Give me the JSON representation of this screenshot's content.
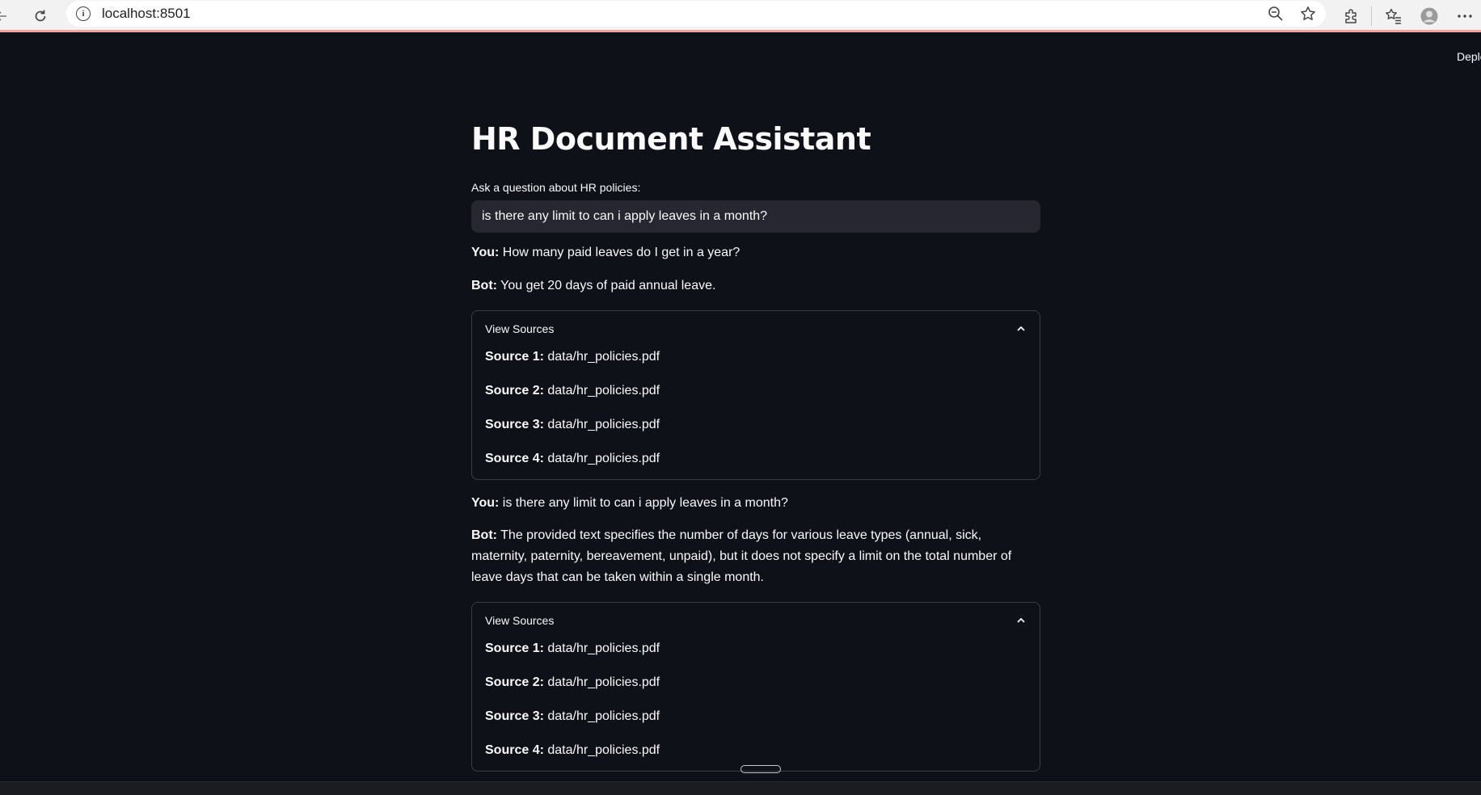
{
  "browser": {
    "url": "localhost:8501"
  },
  "app": {
    "deploy_label": "Deploy",
    "title": "HR Document Assistant",
    "question_label": "Ask a question about HR policies:",
    "question_value": "is there any limit to can i apply leaves in a month?"
  },
  "chat": [
    {
      "you_label": "You:",
      "you_text": " How many paid leaves do I get in a year?",
      "bot_label": "Bot:",
      "bot_text": " You get 20 days of paid annual leave.",
      "expander_label": "View Sources",
      "sources": [
        {
          "label": "Source 1:",
          "value": " data/hr_policies.pdf"
        },
        {
          "label": "Source 2:",
          "value": " data/hr_policies.pdf"
        },
        {
          "label": "Source 3:",
          "value": " data/hr_policies.pdf"
        },
        {
          "label": "Source 4:",
          "value": " data/hr_policies.pdf"
        }
      ]
    },
    {
      "you_label": "You:",
      "you_text": " is there any limit to can i apply leaves in a month?",
      "bot_label": "Bot:",
      "bot_text": " The provided text specifies the number of days for various leave types (annual, sick, maternity, paternity, bereavement, unpaid), but it does not specify a limit on the total number of leave days that can be taken within a single month.",
      "expander_label": "View Sources",
      "sources": [
        {
          "label": "Source 1:",
          "value": " data/hr_policies.pdf"
        },
        {
          "label": "Source 2:",
          "value": " data/hr_policies.pdf"
        },
        {
          "label": "Source 3:",
          "value": " data/hr_policies.pdf"
        },
        {
          "label": "Source 4:",
          "value": " data/hr_policies.pdf"
        }
      ]
    }
  ],
  "icons": {
    "back": "back-arrow-icon",
    "reload": "reload-icon",
    "info": "site-info-icon",
    "zoom": "zoom-out-icon",
    "favorite": "star-icon",
    "extensions": "puzzle-icon",
    "favorites_list": "favorites-icon",
    "profile": "profile-icon",
    "menu": "more-icon",
    "expander": "chevron-up-icon"
  },
  "colors": {
    "app_background": "#0e1117",
    "input_background": "#262730",
    "text": "#fafafa",
    "border": "#3a3d45"
  }
}
